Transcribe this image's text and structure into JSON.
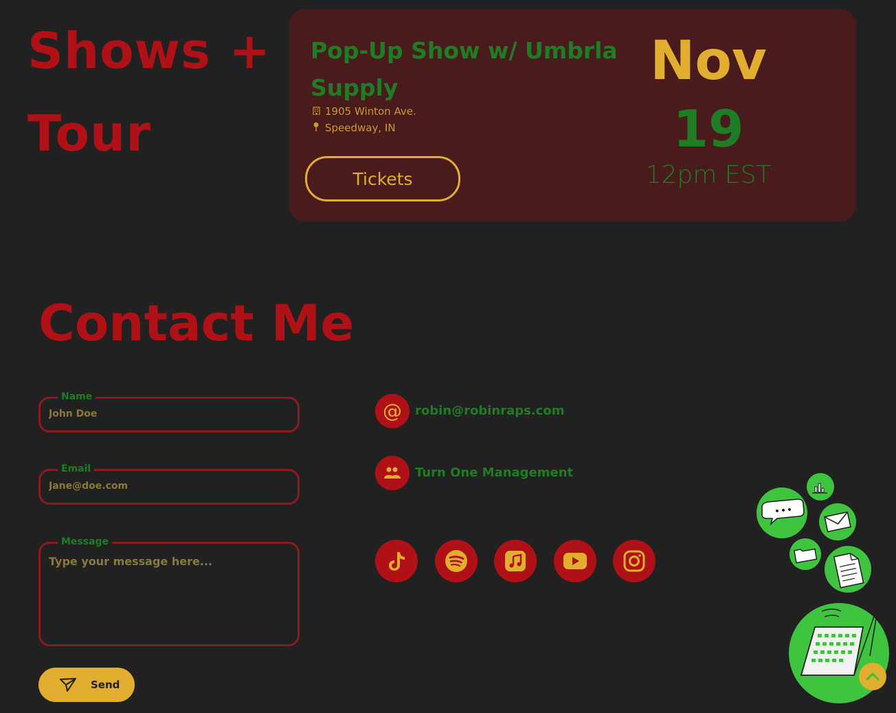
{
  "shows": {
    "title": "Shows + Tour",
    "event": {
      "name": "Pop-Up Show w/ Umbrla Supply",
      "address": "1905 Winton Ave.",
      "city": "Speedway, IN",
      "tickets_label": "Tickets",
      "month": "Nov",
      "day": "19",
      "time": "12pm EST",
      "building_icon": "building-icon",
      "pin_icon": "map-pin-icon"
    }
  },
  "contact": {
    "title": "Contact Me",
    "form": {
      "name_label": "Name",
      "name_placeholder": "John Doe",
      "email_label": "Email",
      "email_placeholder": "Jane@doe.com",
      "message_label": "Message",
      "message_placeholder": "Type your message here...",
      "send_label": "Send"
    },
    "email": "robin@robinraps.com",
    "management": "Turn One Management",
    "socials": [
      "TikTok",
      "Spotify",
      "Apple Music",
      "YouTube",
      "Instagram"
    ]
  },
  "colors": {
    "background": "#212121",
    "red": "#b01116",
    "green": "#1e7d23",
    "gold": "#e2ae2f",
    "card": "#4a1b1c",
    "bubble_green": "#3ec43f"
  }
}
